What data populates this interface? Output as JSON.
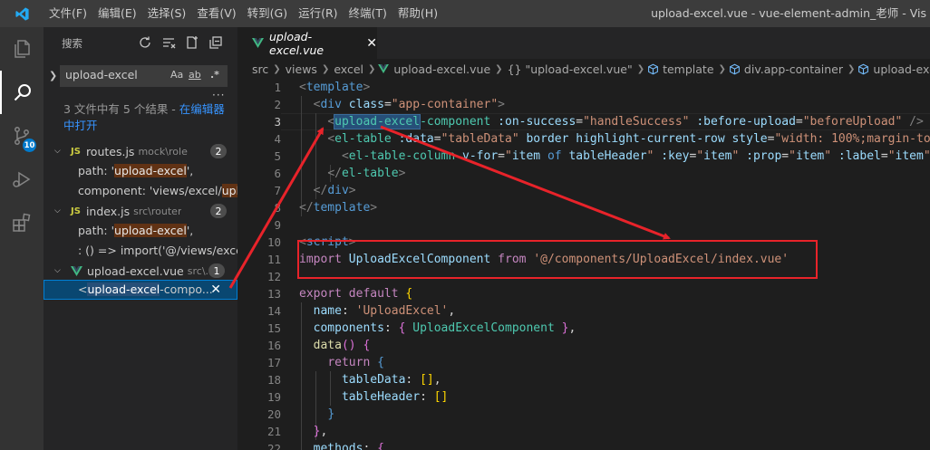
{
  "titlebar": {
    "menus": [
      "文件(F)",
      "编辑(E)",
      "选择(S)",
      "查看(V)",
      "转到(G)",
      "运行(R)",
      "终端(T)",
      "帮助(H)"
    ],
    "window_title": "upload-excel.vue - vue-element-admin_老师 - Vis"
  },
  "activitybar": {
    "icons": [
      "explorer-icon",
      "search-icon",
      "source-control-icon",
      "run-debug-icon",
      "extensions-icon"
    ],
    "scm_badge": "10"
  },
  "sidebar": {
    "title": "搜索",
    "search_value": "upload-excel",
    "match_case": "Aa",
    "whole_word": "ab",
    "regex": ".*",
    "summary_prefix": "3 文件中有 5 个结果 - ",
    "summary_link": "在编辑器中打开",
    "files": [
      {
        "name": "routes.js",
        "path": "mock\\role",
        "count": "2",
        "type": "js",
        "matches": [
          {
            "pre": "path: '",
            "hit": "upload-excel",
            "post": "',"
          },
          {
            "pre": "component: 'views/excel/",
            "hit": "upl",
            "post": "..."
          }
        ]
      },
      {
        "name": "index.js",
        "path": "src\\router",
        "count": "2",
        "type": "js",
        "matches": [
          {
            "pre": "path: '",
            "hit": "upload-excel",
            "post": "',"
          },
          {
            "pre": ": () => import('@/views/exce...",
            "hit": "",
            "post": ""
          }
        ]
      },
      {
        "name": "upload-excel.vue",
        "path": "src\\...",
        "count": "1",
        "type": "vue",
        "matches": [
          {
            "pre": "<",
            "hit": "upload-excel",
            "post": "-compo..."
          }
        ]
      }
    ]
  },
  "tabs": [
    {
      "label": "upload-excel.vue"
    }
  ],
  "breadcrumbs": [
    "src",
    "views",
    "excel",
    "upload-excel.vue",
    "{} \"upload-excel.vue\"",
    "template",
    "div.app-container",
    "upload-excel-comp"
  ],
  "editor": {
    "line_numbers": [
      "1",
      "2",
      "3",
      "4",
      "5",
      "6",
      "7",
      "8",
      "9",
      "10",
      "11",
      "12",
      "13",
      "14",
      "15",
      "16",
      "17",
      "18",
      "19",
      "20",
      "21",
      "22"
    ],
    "current_line": 3
  },
  "colors": {
    "accent": "#007acc",
    "annotation": "#e8232a",
    "selection": "#264f78"
  }
}
